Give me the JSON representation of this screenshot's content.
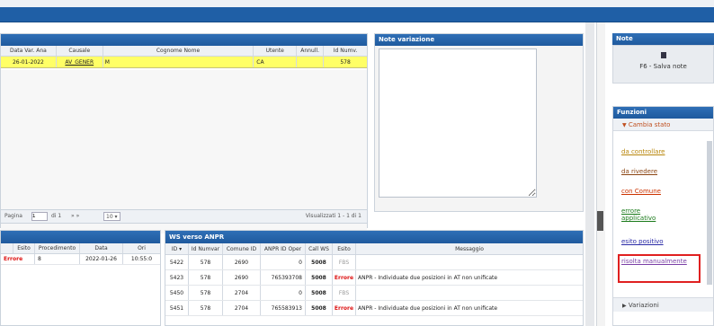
{
  "variations": {
    "columns": [
      "Data Var. Ana",
      "Causale",
      "Cognome Nome",
      "Utente",
      "Annull.",
      "Id Numv."
    ],
    "rows": [
      {
        "date": "26-01-2022",
        "causale": "AV_GENER",
        "name": "M",
        "user": "CA",
        "annull": "",
        "id": "578"
      }
    ],
    "pager": {
      "page_label": "Pagina",
      "page_value": "1",
      "of_label": "di 1",
      "nav": "» »",
      "size": "10",
      "summary": "Visualizzati 1 - 1 di 1"
    }
  },
  "notes": {
    "title": "Note variazione"
  },
  "right": {
    "note_title": "Note",
    "save_label": "F6 - Salva note",
    "functions_title": "Funzioni",
    "cambia_stato": "Cambia stato",
    "links": [
      {
        "label": "da controllare",
        "color": "#b8860b"
      },
      {
        "label": "da rivedere",
        "color": "#8b4513"
      },
      {
        "label": "con Comune",
        "color": "#cc3300"
      },
      {
        "label": "errore applicativo",
        "color": "#1a7a1a"
      },
      {
        "label": "esito positivo",
        "color": "#2a2aa6"
      },
      {
        "label": "risolta manualmente",
        "color": "#7a3fa6"
      }
    ],
    "variazioni": "Variazioni"
  },
  "procedures": {
    "columns": [
      "Esito",
      "Procedimento",
      "Data",
      "Ora"
    ],
    "col_short": [
      "Esito",
      "Procedimento",
      "Data",
      "Ori"
    ],
    "rows": [
      {
        "esito": "Errore",
        "proc": "8",
        "date": "2022-01-26",
        "time": "10:55:0"
      }
    ]
  },
  "ws": {
    "title": "WS verso ANPR",
    "columns": [
      "ID ▾",
      "Id Numvar",
      "Comune ID",
      "ANPR ID Oper",
      "Call WS",
      "Esito",
      "Messaggio"
    ],
    "rows": [
      {
        "id": "5422",
        "numvar": "578",
        "comune": "2690",
        "oper": "0",
        "call": "5008",
        "esito": "FBS",
        "msg": ""
      },
      {
        "id": "5423",
        "numvar": "578",
        "comune": "2690",
        "oper": "765393708",
        "call": "5008",
        "esito": "Errore",
        "msg": "ANPR - Individuate due posizioni in AT non unificate"
      },
      {
        "id": "5450",
        "numvar": "578",
        "comune": "2704",
        "oper": "0",
        "call": "5008",
        "esito": "FBS",
        "msg": ""
      },
      {
        "id": "5451",
        "numvar": "578",
        "comune": "2704",
        "oper": "765583913",
        "call": "5008",
        "esito": "Errore",
        "msg": "ANPR - Individuate due posizioni in AT non unificate"
      }
    ]
  },
  "colors": {
    "header_blue": "#1f5fa6",
    "highlight": "#ffff66",
    "error": "#dd1111",
    "callout": "#e02020"
  }
}
